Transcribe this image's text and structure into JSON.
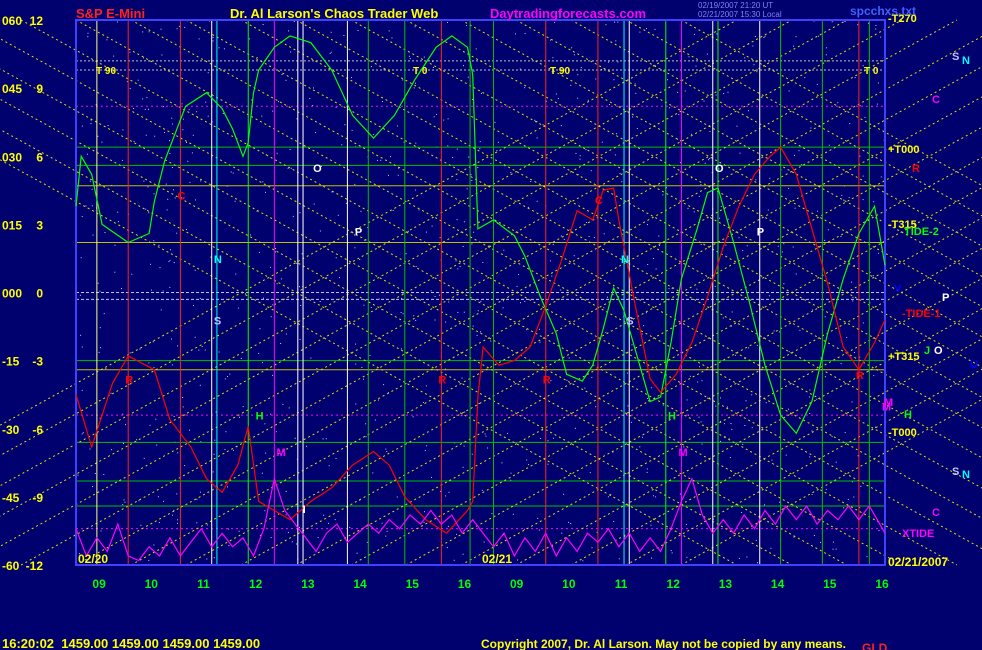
{
  "header": {
    "instrument": "S&P E-Mini",
    "title": "Dr. Al Larson's Chaos Trader Web",
    "site": "Daytradingforecasts.com",
    "file": "spcchxs.txt",
    "stamp1": "02/19/2007 21:20 UT",
    "stamp2": "02/21/2007 15:30 Local"
  },
  "footer": {
    "readout": "16:20:02  1459.00 1459.00 1459.00 1459.00",
    "copyright": "Copyright 2007, Dr. Al Larson. May not be copied by any means.",
    "extra": "GLD"
  },
  "colors": {
    "background": "#00006e",
    "price_line": "#ff0000",
    "tide_line": "#00ff00",
    "xtide_line": "#ff00ff",
    "grid": "#ffff00"
  },
  "chart_data": {
    "type": "line",
    "left_axis_outer": [
      "060",
      "045",
      "030",
      "015",
      "000",
      "-15",
      "-30",
      "-45",
      "-60"
    ],
    "left_axis_inner": [
      "12",
      "9",
      "6",
      "3",
      "0",
      "-3",
      "-6",
      "-9",
      "-12"
    ],
    "y_range": [
      -12,
      12
    ],
    "x_ticks": [
      "09",
      "10",
      "11",
      "12",
      "13",
      "14",
      "15",
      "16",
      "09",
      "10",
      "11",
      "12",
      "13",
      "14",
      "15",
      "16"
    ],
    "date_labels": [
      "02/20",
      "02/21",
      "02/21/2007"
    ],
    "x_range_hours": [
      8.5,
      24.0
    ],
    "right_labels": [
      {
        "text": "-T270",
        "color": "#ffff00"
      },
      {
        "text": "S",
        "color": "#c0c0ff"
      },
      {
        "text": "N",
        "color": "#00ffff"
      },
      {
        "text": "C",
        "color": "#ff00ff"
      },
      {
        "text": "+T000",
        "color": "#ffff00"
      },
      {
        "text": "R",
        "color": "#ff0000"
      },
      {
        "text": "-T315",
        "color": "#ffff00"
      },
      {
        "text": "TIDE-2",
        "color": "#00ff00"
      },
      {
        "text": "V",
        "color": "#0000ff"
      },
      {
        "text": "P",
        "color": "#ffffff"
      },
      {
        "text": "-TIDE-1",
        "color": "#ff0000"
      },
      {
        "text": "+T315",
        "color": "#ffff00"
      },
      {
        "text": "J",
        "color": "#00ff00"
      },
      {
        "text": "O",
        "color": "#ffffff"
      },
      {
        "text": "U",
        "color": "#0000ff"
      },
      {
        "text": "M",
        "color": "#ff00ff"
      },
      {
        "text": "H",
        "color": "#00ff00"
      },
      {
        "text": "-T000",
        "color": "#ffff00"
      },
      {
        "text": "S",
        "color": "#c0c0ff"
      },
      {
        "text": "N",
        "color": "#00ffff"
      },
      {
        "text": "C",
        "color": "#ff00ff"
      },
      {
        "text": "XTIDE",
        "color": "#ff00ff"
      }
    ],
    "t_markers": [
      "T 90",
      "T 0",
      "T 90",
      "T 0"
    ],
    "planet_labels": [
      {
        "text": "C",
        "color": "#ff0000",
        "hour": 10.5,
        "y": 4.1
      },
      {
        "text": "N",
        "color": "#00ffff",
        "hour": 11.2,
        "y": 1.3
      },
      {
        "text": "S",
        "color": "#c0c0ff",
        "hour": 11.2,
        "y": -1.4
      },
      {
        "text": "R",
        "color": "#ff0000",
        "hour": 9.5,
        "y": -4.0
      },
      {
        "text": "H",
        "color": "#00ff00",
        "hour": 12.0,
        "y": -5.6
      },
      {
        "text": "M",
        "color": "#ff00ff",
        "hour": 12.4,
        "y": -7.2
      },
      {
        "text": "I",
        "color": "#ffffff",
        "hour": 12.9,
        "y": -9.7
      },
      {
        "text": "O",
        "color": "#ffffff",
        "hour": 13.1,
        "y": 5.3
      },
      {
        "text": "P",
        "color": "#ffffff",
        "hour": 13.9,
        "y": 2.5
      },
      {
        "text": "R",
        "color": "#ff0000",
        "hour": 15.5,
        "y": -4.0
      },
      {
        "text": "R",
        "color": "#ff0000",
        "hour": 17.5,
        "y": -4.0
      },
      {
        "text": "C",
        "color": "#ff0000",
        "hour": 18.5,
        "y": 3.9
      },
      {
        "text": "N",
        "color": "#00ffff",
        "hour": 19.0,
        "y": 1.3
      },
      {
        "text": "S",
        "color": "#c0c0ff",
        "hour": 19.1,
        "y": -1.4
      },
      {
        "text": "H",
        "color": "#00ff00",
        "hour": 19.9,
        "y": -5.6
      },
      {
        "text": "M",
        "color": "#ff00ff",
        "hour": 20.1,
        "y": -7.2
      },
      {
        "text": "O",
        "color": "#ffffff",
        "hour": 20.8,
        "y": 5.3
      },
      {
        "text": "P",
        "color": "#ffffff",
        "hour": 21.6,
        "y": 2.5
      },
      {
        "text": "R",
        "color": "#ff0000",
        "hour": 23.5,
        "y": -3.8
      },
      {
        "text": "M",
        "color": "#ff00ff",
        "hour": 24.0,
        "y": -5.2
      }
    ],
    "series": [
      {
        "color": "#00ff00",
        "points": [
          [
            8.5,
            3.8
          ],
          [
            8.6,
            6.0
          ],
          [
            8.8,
            5.2
          ],
          [
            9.0,
            3.0
          ],
          [
            9.5,
            2.2
          ],
          [
            9.9,
            2.6
          ],
          [
            10.0,
            4.0
          ],
          [
            10.2,
            5.8
          ],
          [
            10.6,
            8.2
          ],
          [
            11.0,
            8.8
          ],
          [
            11.3,
            8.1
          ],
          [
            11.5,
            7.2
          ],
          [
            11.7,
            6.0
          ],
          [
            11.8,
            6.6
          ],
          [
            11.9,
            8.8
          ],
          [
            12.0,
            9.8
          ],
          [
            12.3,
            10.8
          ],
          [
            12.6,
            11.3
          ],
          [
            13.0,
            11.0
          ],
          [
            13.4,
            9.8
          ],
          [
            13.8,
            7.8
          ],
          [
            14.2,
            6.8
          ],
          [
            14.6,
            7.8
          ],
          [
            15.0,
            9.4
          ],
          [
            15.4,
            10.8
          ],
          [
            15.7,
            11.3
          ],
          [
            16.0,
            10.8
          ],
          [
            16.1,
            9.6
          ],
          [
            16.2,
            2.8
          ],
          [
            16.5,
            3.2
          ],
          [
            16.9,
            2.5
          ],
          [
            17.1,
            1.6
          ],
          [
            17.4,
            -0.2
          ],
          [
            17.7,
            -1.8
          ],
          [
            17.9,
            -3.6
          ],
          [
            18.2,
            -3.9
          ],
          [
            18.4,
            -3.2
          ],
          [
            18.6,
            -1.6
          ],
          [
            18.8,
            0.2
          ],
          [
            19.0,
            -0.8
          ],
          [
            19.3,
            -3.2
          ],
          [
            19.5,
            -4.8
          ],
          [
            19.7,
            -4.6
          ],
          [
            19.9,
            -2.2
          ],
          [
            20.1,
            0.6
          ],
          [
            20.4,
            2.8
          ],
          [
            20.6,
            4.4
          ],
          [
            20.8,
            4.6
          ],
          [
            21.1,
            2.2
          ],
          [
            21.4,
            -0.4
          ],
          [
            21.7,
            -3.2
          ],
          [
            22.0,
            -5.4
          ],
          [
            22.3,
            -6.2
          ],
          [
            22.6,
            -4.8
          ],
          [
            22.9,
            -1.8
          ],
          [
            23.2,
            0.6
          ],
          [
            23.5,
            2.6
          ],
          [
            23.8,
            3.8
          ],
          [
            24.0,
            1.2
          ]
        ]
      },
      {
        "color": "#ff0000",
        "points": [
          [
            8.5,
            -4.5
          ],
          [
            8.8,
            -6.8
          ],
          [
            9.2,
            -4.0
          ],
          [
            9.5,
            -2.8
          ],
          [
            10.0,
            -3.4
          ],
          [
            10.3,
            -5.6
          ],
          [
            10.7,
            -6.8
          ],
          [
            11.0,
            -8.2
          ],
          [
            11.3,
            -8.8
          ],
          [
            11.6,
            -7.6
          ],
          [
            11.8,
            -5.9
          ],
          [
            12.0,
            -9.2
          ],
          [
            12.3,
            -9.6
          ],
          [
            12.6,
            -10.0
          ],
          [
            13.0,
            -9.2
          ],
          [
            13.4,
            -8.6
          ],
          [
            13.8,
            -7.6
          ],
          [
            14.2,
            -7.0
          ],
          [
            14.5,
            -7.6
          ],
          [
            14.8,
            -9.0
          ],
          [
            15.2,
            -10.0
          ],
          [
            15.6,
            -10.6
          ],
          [
            16.0,
            -9.6
          ],
          [
            16.1,
            -9.2
          ],
          [
            16.2,
            -4.6
          ],
          [
            16.3,
            -2.4
          ],
          [
            16.6,
            -3.2
          ],
          [
            16.9,
            -3.0
          ],
          [
            17.2,
            -2.4
          ],
          [
            17.5,
            -0.6
          ],
          [
            17.8,
            1.4
          ],
          [
            18.1,
            3.6
          ],
          [
            18.4,
            3.2
          ],
          [
            18.6,
            4.5
          ],
          [
            18.8,
            4.6
          ],
          [
            18.9,
            3.2
          ],
          [
            19.2,
            -0.4
          ],
          [
            19.5,
            -3.8
          ],
          [
            19.7,
            -4.4
          ],
          [
            20.0,
            -3.6
          ],
          [
            20.3,
            -2.2
          ],
          [
            20.6,
            -0.2
          ],
          [
            20.9,
            2.0
          ],
          [
            21.2,
            3.8
          ],
          [
            21.5,
            5.2
          ],
          [
            21.8,
            6.0
          ],
          [
            22.0,
            6.4
          ],
          [
            22.3,
            5.2
          ],
          [
            22.6,
            2.8
          ],
          [
            22.9,
            0.4
          ],
          [
            23.2,
            -2.4
          ],
          [
            23.5,
            -3.4
          ],
          [
            23.8,
            -2.2
          ],
          [
            24.0,
            -1.2
          ]
        ]
      },
      {
        "color": "#ff00ff",
        "points": [
          [
            8.5,
            -10.4
          ],
          [
            8.7,
            -11.6
          ],
          [
            8.9,
            -10.8
          ],
          [
            9.1,
            -11.4
          ],
          [
            9.3,
            -10.2
          ],
          [
            9.5,
            -11.6
          ],
          [
            9.7,
            -11.8
          ],
          [
            9.9,
            -11.2
          ],
          [
            10.1,
            -11.6
          ],
          [
            10.3,
            -10.8
          ],
          [
            10.5,
            -11.6
          ],
          [
            10.7,
            -11.0
          ],
          [
            10.9,
            -10.4
          ],
          [
            11.1,
            -11.2
          ],
          [
            11.3,
            -10.6
          ],
          [
            11.5,
            -11.2
          ],
          [
            11.7,
            -10.8
          ],
          [
            11.9,
            -11.6
          ],
          [
            12.1,
            -10.4
          ],
          [
            12.3,
            -8.2
          ],
          [
            12.5,
            -9.6
          ],
          [
            12.7,
            -10.2
          ],
          [
            12.9,
            -10.8
          ],
          [
            13.1,
            -11.4
          ],
          [
            13.3,
            -10.6
          ],
          [
            13.5,
            -10.2
          ],
          [
            13.7,
            -11.0
          ],
          [
            13.9,
            -10.6
          ],
          [
            14.1,
            -10.2
          ],
          [
            14.3,
            -10.6
          ],
          [
            14.5,
            -10.0
          ],
          [
            14.7,
            -10.4
          ],
          [
            14.9,
            -9.8
          ],
          [
            15.1,
            -10.2
          ],
          [
            15.3,
            -9.6
          ],
          [
            15.5,
            -10.2
          ],
          [
            15.7,
            -9.8
          ],
          [
            15.9,
            -10.6
          ],
          [
            16.1,
            -10.0
          ],
          [
            16.3,
            -10.6
          ],
          [
            16.5,
            -11.2
          ],
          [
            16.7,
            -10.6
          ],
          [
            16.9,
            -11.6
          ],
          [
            17.1,
            -10.8
          ],
          [
            17.3,
            -11.4
          ],
          [
            17.5,
            -10.6
          ],
          [
            17.7,
            -11.6
          ],
          [
            17.9,
            -10.8
          ],
          [
            18.1,
            -11.4
          ],
          [
            18.3,
            -10.6
          ],
          [
            18.5,
            -11.0
          ],
          [
            18.7,
            -10.4
          ],
          [
            18.9,
            -11.2
          ],
          [
            19.1,
            -10.6
          ],
          [
            19.3,
            -11.4
          ],
          [
            19.5,
            -10.8
          ],
          [
            19.7,
            -11.4
          ],
          [
            19.9,
            -10.4
          ],
          [
            20.1,
            -9.2
          ],
          [
            20.3,
            -8.2
          ],
          [
            20.5,
            -9.8
          ],
          [
            20.7,
            -10.6
          ],
          [
            20.9,
            -10.0
          ],
          [
            21.1,
            -10.6
          ],
          [
            21.3,
            -9.8
          ],
          [
            21.5,
            -10.4
          ],
          [
            21.7,
            -9.6
          ],
          [
            21.9,
            -10.2
          ],
          [
            22.1,
            -9.4
          ],
          [
            22.3,
            -10.0
          ],
          [
            22.5,
            -9.4
          ],
          [
            22.7,
            -10.2
          ],
          [
            22.9,
            -9.6
          ],
          [
            23.1,
            -10.0
          ],
          [
            23.3,
            -9.4
          ],
          [
            23.5,
            -10.0
          ],
          [
            23.7,
            -9.4
          ],
          [
            23.9,
            -10.2
          ],
          [
            24.0,
            -10.6
          ]
        ]
      }
    ]
  }
}
